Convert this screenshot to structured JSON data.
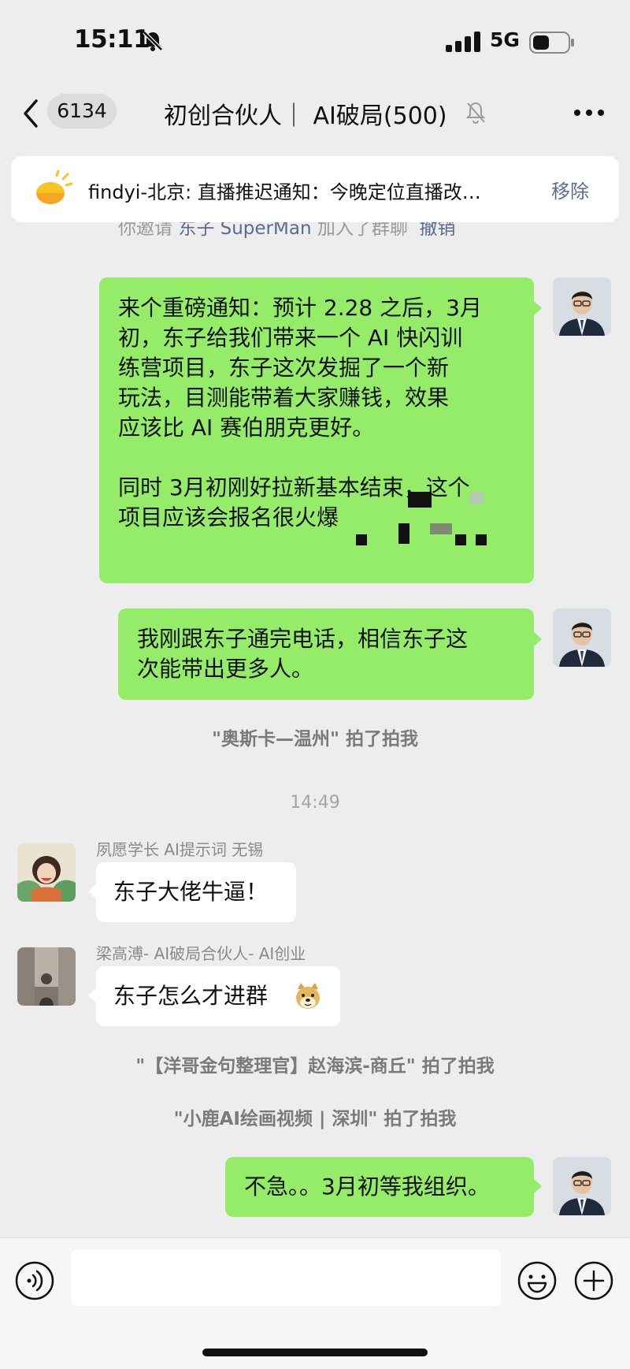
{
  "status_bar": {
    "time": "15:11",
    "network": "5G"
  },
  "header": {
    "unread_count": "6134",
    "title": "初创合伙人｜ AI破局(500)"
  },
  "pinned_notice": {
    "text": "findyi-北京: 直播推迟通知：今晚定位直播改…",
    "action": "移除"
  },
  "system_cut": {
    "prefix": "你邀请 ",
    "name": "东子 SuperMan",
    "suffix": " 加入了群聊  ",
    "action": "撤销"
  },
  "messages": {
    "m1": {
      "text": "来个重磅通知：预计 2.28 之后，3月\n初，东子给我们带来一个 AI 快闪训\n练营项目，东子这次发掘了一个新\n玩法，目测能带着大家赚钱，效果\n应该比 AI 赛伯朋克更好。\n\n同时 3月初刚好拉新基本结束，这个\n项目应该会报名很火爆"
    },
    "m2": {
      "text": "我刚跟东子通完电话，相信东子这\n次能带出更多人。"
    },
    "pat1": "\"奥斯卡—温州\" 拍了拍我",
    "time1": "14:49",
    "m3": {
      "sender": "夙愿学长 AI提示词 无锡",
      "text": "东子大佬牛逼！"
    },
    "m4": {
      "sender": "梁高溥- AI破局合伙人- AI创业",
      "text": "东子怎么才进群"
    },
    "pat2": "\"【洋哥金句整理官】赵海滨-商丘\" 拍了拍我",
    "pat3": "\"小鹿AI绘画视频 | 深圳\" 拍了拍我",
    "m5": {
      "text": "不急。。3月初等我组织。"
    }
  },
  "icons": {
    "status": [
      "bell-slash-icon",
      "signal-icon",
      "battery-icon"
    ],
    "header": [
      "back-chevron-icon",
      "mute-bell-icon",
      "more-icon"
    ],
    "pinned": "sun-icon",
    "emoji_in_message": "doge-emoji-icon",
    "input": [
      "voice-icon",
      "emoji-icon",
      "plus-icon"
    ]
  },
  "colors": {
    "self_bubble": "#95ec69",
    "other_bubble": "#ffffff",
    "background": "#ededed",
    "link": "#5b6a91"
  }
}
